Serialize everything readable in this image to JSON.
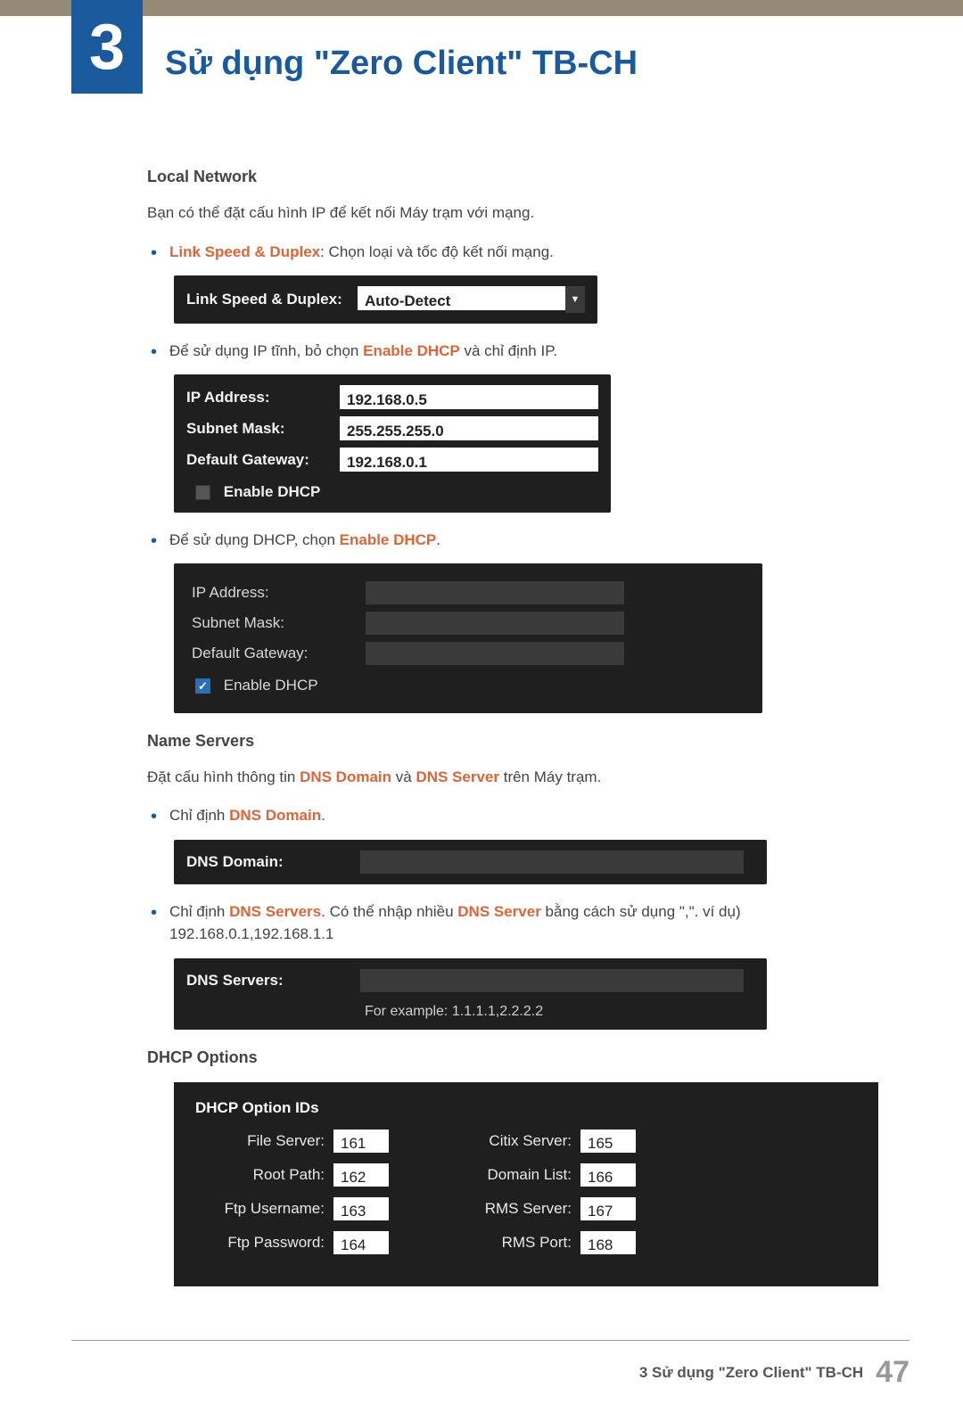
{
  "chapter": {
    "num": "3",
    "title": "Sử dụng \"Zero Client\" TB-CH"
  },
  "local_network": {
    "heading": "Local Network",
    "intro": "Bạn có thể đặt cấu hình IP để kết nối Máy trạm với mạng.",
    "link_speed_bullet_label": "Link Speed & Duplex",
    "link_speed_bullet_rest": ": Chọn loại và tốc độ kết nối mạng.",
    "link_speed_label": "Link Speed & Duplex:",
    "link_speed_value": "Auto-Detect",
    "static_ip_bullet_pre": "Để sử dụng IP tĩnh, bỏ chọn ",
    "static_ip_bullet_bold": "Enable DHCP",
    "static_ip_bullet_post": " và chỉ định IP.",
    "ip_label": "IP Address:",
    "ip_value": "192.168.0.5",
    "subnet_label": "Subnet Mask:",
    "subnet_value": "255.255.255.0",
    "gateway_label": "Default Gateway:",
    "gateway_value": "192.168.0.1",
    "enable_dhcp_label": "Enable DHCP",
    "dhcp_on_bullet_pre": "Để sử dụng DHCP, chọn ",
    "dhcp_on_bullet_bold": "Enable DHCP",
    "dhcp_on_bullet_post": "."
  },
  "name_servers": {
    "heading": "Name Servers",
    "intro_pre": "Đặt cấu hình thông tin ",
    "intro_b1": "DNS Domain",
    "intro_mid": " và ",
    "intro_b2": "DNS Server",
    "intro_post": " trên Máy trạm.",
    "dns_domain_bullet_pre": "Chỉ định ",
    "dns_domain_bullet_bold": "DNS Domain",
    "dns_domain_bullet_post": ".",
    "dns_domain_label": "DNS Domain:",
    "dns_servers_bullet_pre": "Chỉ định ",
    "dns_servers_bullet_b1": "DNS Servers",
    "dns_servers_bullet_mid": ". Có thể nhập nhiều ",
    "dns_servers_bullet_b2": "DNS Server",
    "dns_servers_bullet_post": " bằng cách sử dụng \",\". ví dụ) 192.168.0.1,192.168.1.1",
    "dns_servers_label": "DNS Servers:",
    "dns_example": "For example: 1.1.1.1,2.2.2.2"
  },
  "dhcp_options": {
    "heading": "DHCP Options",
    "panel_title": "DHCP Option IDs",
    "left": [
      {
        "label": "File Server:",
        "value": "161"
      },
      {
        "label": "Root Path:",
        "value": "162"
      },
      {
        "label": "Ftp Username:",
        "value": "163"
      },
      {
        "label": "Ftp Password:",
        "value": "164"
      }
    ],
    "right": [
      {
        "label": "Citix Server:",
        "value": "165"
      },
      {
        "label": "Domain List:",
        "value": "166"
      },
      {
        "label": "RMS Server:",
        "value": "167"
      },
      {
        "label": "RMS Port:",
        "value": "168"
      }
    ]
  },
  "footer": {
    "text": "3 Sử dụng \"Zero Client\" TB-CH",
    "page": "47"
  }
}
